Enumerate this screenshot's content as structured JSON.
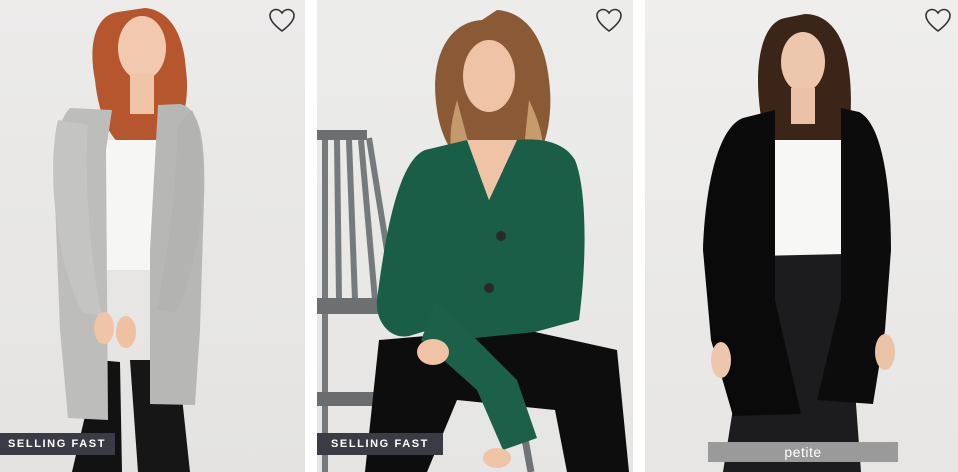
{
  "products": [
    {
      "name": "grey-cardigan",
      "image_description": "grey-knit-long-cardigan",
      "badge": "SELLING FAST",
      "wishlist_icon": "heart-outline-icon"
    },
    {
      "name": "green-cardigan",
      "image_description": "green-v-neck-cardigan",
      "badge": "SELLING FAST",
      "wishlist_icon": "heart-outline-icon"
    },
    {
      "name": "black-cardigan",
      "image_description": "black-long-cardigan",
      "badge": "petite",
      "wishlist_icon": "heart-outline-icon"
    }
  ],
  "colors": {
    "badge_dark": "#3b3b45",
    "badge_petite": "#9a9a9a",
    "heart_stroke": "#333333"
  }
}
